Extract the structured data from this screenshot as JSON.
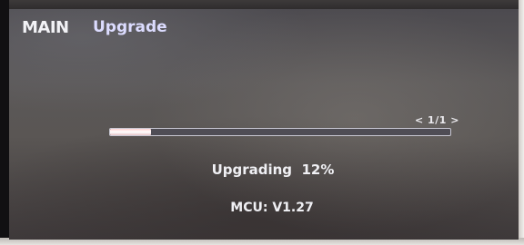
{
  "header": {
    "main_label": "MAIN",
    "title": "Upgrade"
  },
  "upgrade": {
    "page_indicator": "< 1/1 >",
    "progress_percent": 12,
    "status_text": "Upgrading  12%",
    "version_text": "MCU: V1.27"
  },
  "colors": {
    "progress_fill": "#ffffff",
    "title": "#dcdcff",
    "text": "#f0f0f4"
  }
}
